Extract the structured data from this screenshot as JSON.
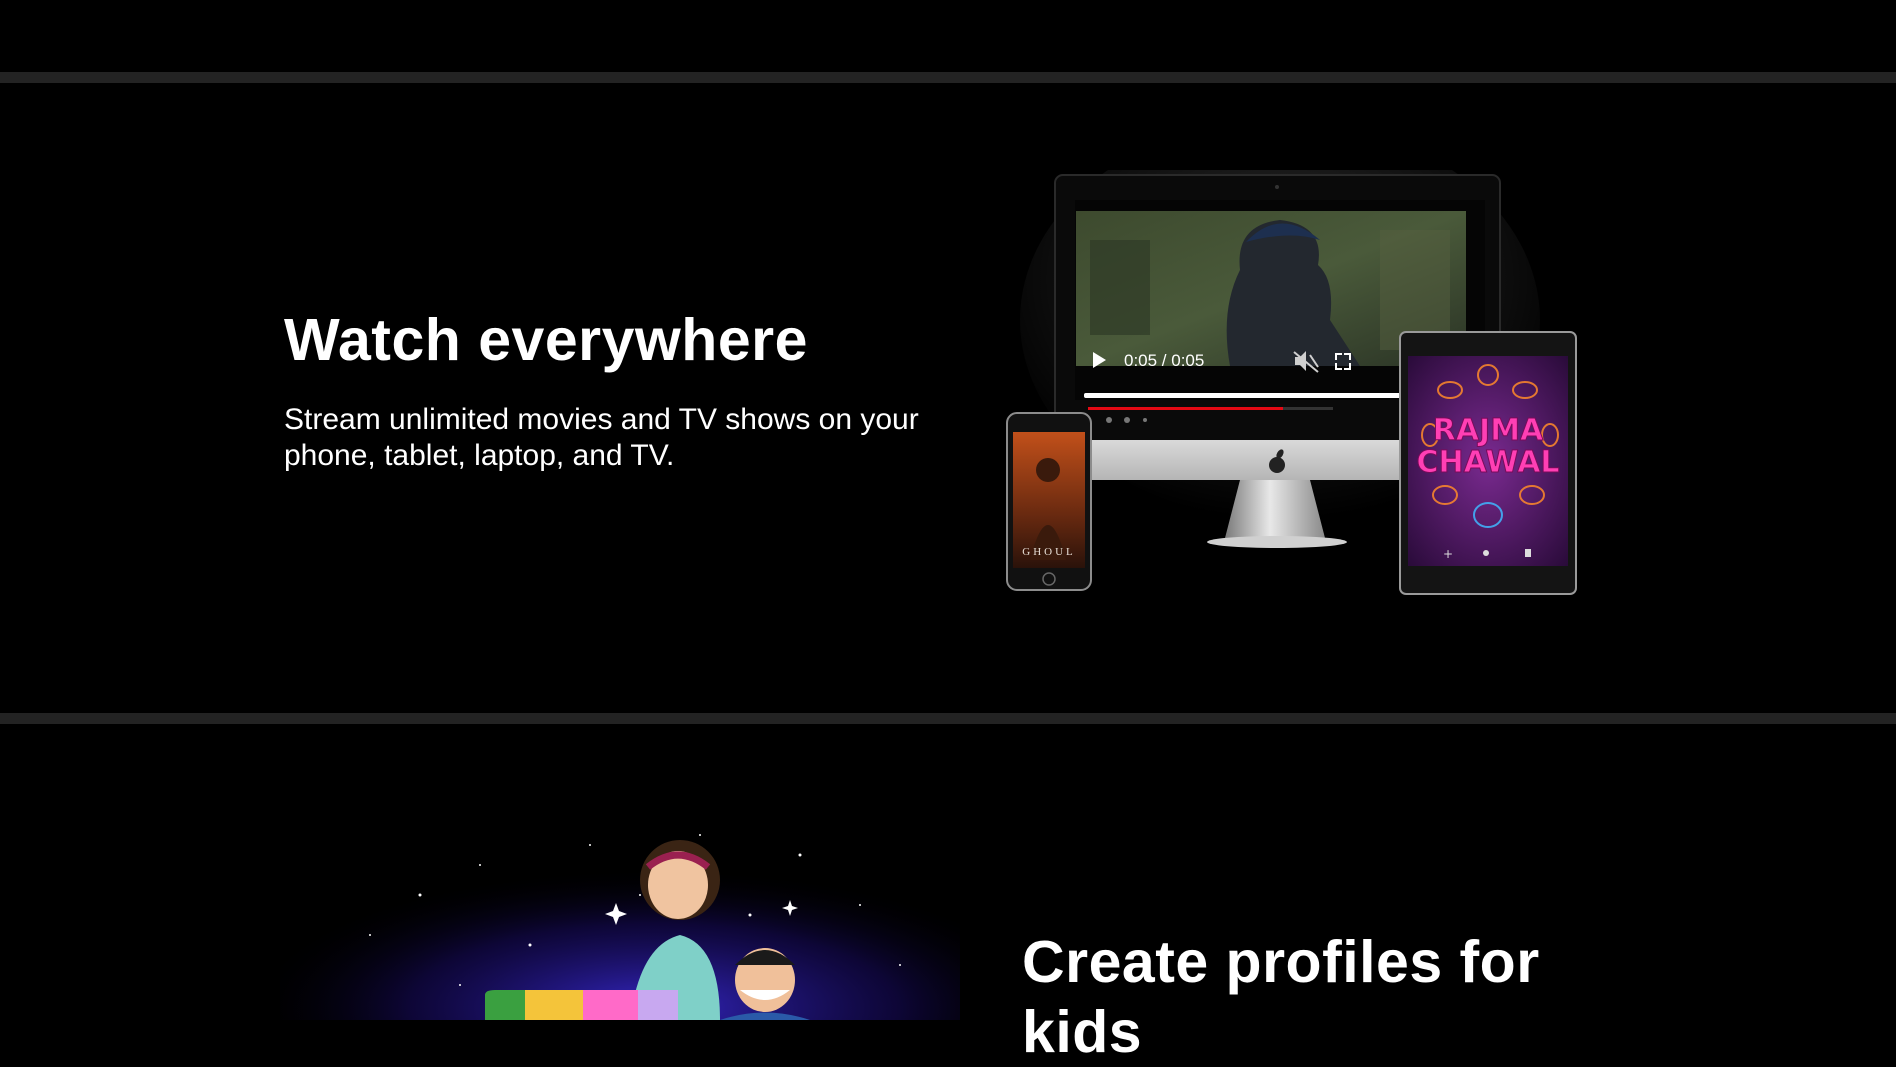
{
  "sections": {
    "watch": {
      "title": "Watch everywhere",
      "description": "Stream unlimited movies and TV shows on your\nphone, tablet, laptop, and TV."
    },
    "kids": {
      "title": "Create profiles for\nkids"
    }
  },
  "video_player": {
    "time": "0:05 / 0:05",
    "play_icon": "play-icon",
    "mute_icon": "muted-speaker-icon",
    "fullscreen_icon": "fullscreen-icon",
    "progress": 1.0
  },
  "phone_poster": {
    "title": "GHOUL"
  },
  "tablet_poster": {
    "title_line1": "RAJMA",
    "title_line2": "CHAWAL"
  },
  "colors": {
    "background": "#000000",
    "divider": "#232323",
    "text": "#ffffff",
    "accent_red": "#e50914",
    "poster_pink": "#ff3fb4"
  }
}
